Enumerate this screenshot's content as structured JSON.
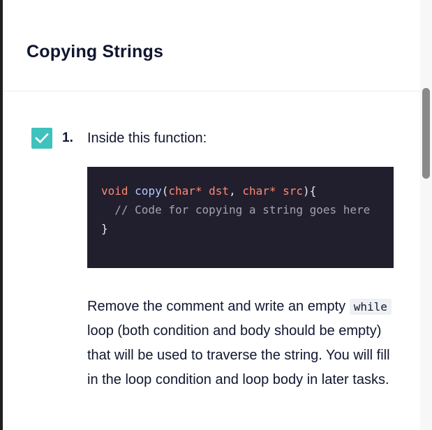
{
  "lesson": {
    "title": "Copying Strings"
  },
  "task": {
    "number": "1.",
    "label": "Inside this function:",
    "completed": true,
    "accent_color": "#3fc2bd",
    "check_icon": "checkmark-icon"
  },
  "code": {
    "lines": [
      {
        "tokens": [
          {
            "text": "void",
            "kind": "kw"
          },
          {
            "text": " ",
            "kind": "punc"
          },
          {
            "text": "copy",
            "kind": "fn"
          },
          {
            "text": "(",
            "kind": "punc"
          },
          {
            "text": "char*",
            "kind": "ty"
          },
          {
            "text": " ",
            "kind": "punc"
          },
          {
            "text": "dst",
            "kind": "var"
          },
          {
            "text": ", ",
            "kind": "punc"
          },
          {
            "text": "char*",
            "kind": "ty"
          },
          {
            "text": " ",
            "kind": "punc"
          },
          {
            "text": "src",
            "kind": "var"
          },
          {
            "text": "){",
            "kind": "punc"
          }
        ]
      },
      {
        "tokens": [
          {
            "text": "  // Code for copying a string goes here",
            "kind": "comment"
          }
        ]
      },
      {
        "tokens": [
          {
            "text": "}",
            "kind": "punc"
          }
        ]
      }
    ]
  },
  "description": {
    "before": "Remove the comment and write an empty ",
    "inline_code": "while",
    "after": " loop (both condition and body should be empty) that will be used to traverse the string. You will fill in the loop condition and loop body in later tasks."
  }
}
